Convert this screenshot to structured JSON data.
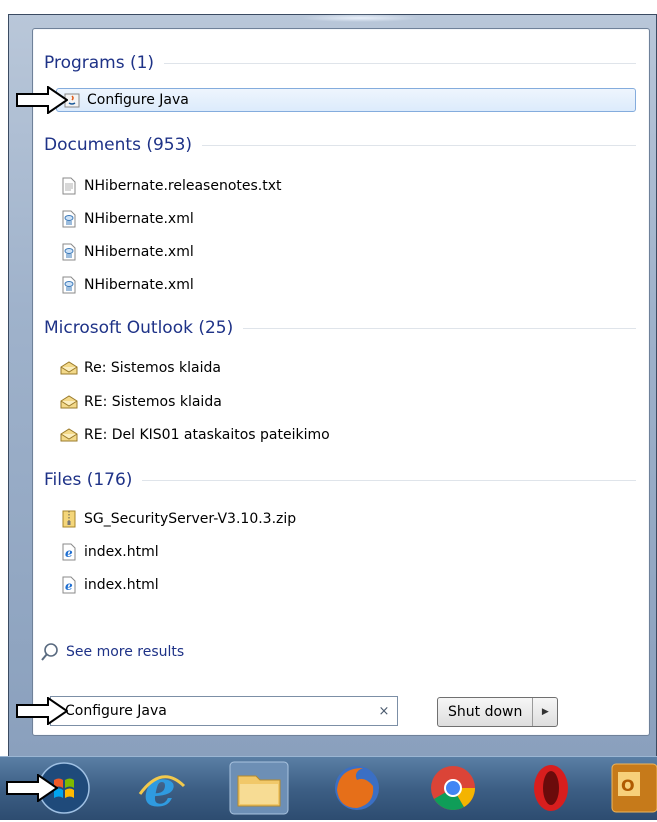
{
  "start_menu": {
    "groups": [
      {
        "title": "Programs (1)",
        "items": [
          {
            "label": "Configure Java",
            "icon": "java-icon",
            "selected": true
          }
        ]
      },
      {
        "title": "Documents (953)",
        "items": [
          {
            "label": "NHibernate.releasenotes.txt",
            "icon": "text-file-icon"
          },
          {
            "label": "NHibernate.xml",
            "icon": "xml-file-icon"
          },
          {
            "label": "NHibernate.xml",
            "icon": "xml-file-icon"
          },
          {
            "label": "NHibernate.xml",
            "icon": "xml-file-icon"
          }
        ]
      },
      {
        "title": "Microsoft Outlook (25)",
        "items": [
          {
            "label": "Re: Sistemos klaida",
            "icon": "email-icon"
          },
          {
            "label": "RE: Sistemos klaida",
            "icon": "email-icon"
          },
          {
            "label": "RE: Del KIS01 ataskaitos pateikimo",
            "icon": "email-icon"
          }
        ]
      },
      {
        "title": "Files (176)",
        "items": [
          {
            "label": "SG_SecurityServer-V3.10.3.zip",
            "icon": "zip-file-icon"
          },
          {
            "label": "index.html",
            "icon": "ie-file-icon"
          },
          {
            "label": "index.html",
            "icon": "ie-file-icon"
          }
        ]
      }
    ],
    "see_more": "See more results",
    "search_value": "Configure Java",
    "clear_symbol": "×",
    "shutdown_label": "Shut down",
    "shutdown_arrow": "▶"
  },
  "taskbar": {
    "items": [
      "start-orb-icon",
      "internet-explorer-icon",
      "file-explorer-icon",
      "firefox-icon",
      "chrome-icon",
      "opera-icon",
      "outlook-icon"
    ]
  },
  "colors": {
    "group_title": "#1e3287",
    "selection_border": "#84acdd",
    "taskbar": "#3d5f85"
  }
}
